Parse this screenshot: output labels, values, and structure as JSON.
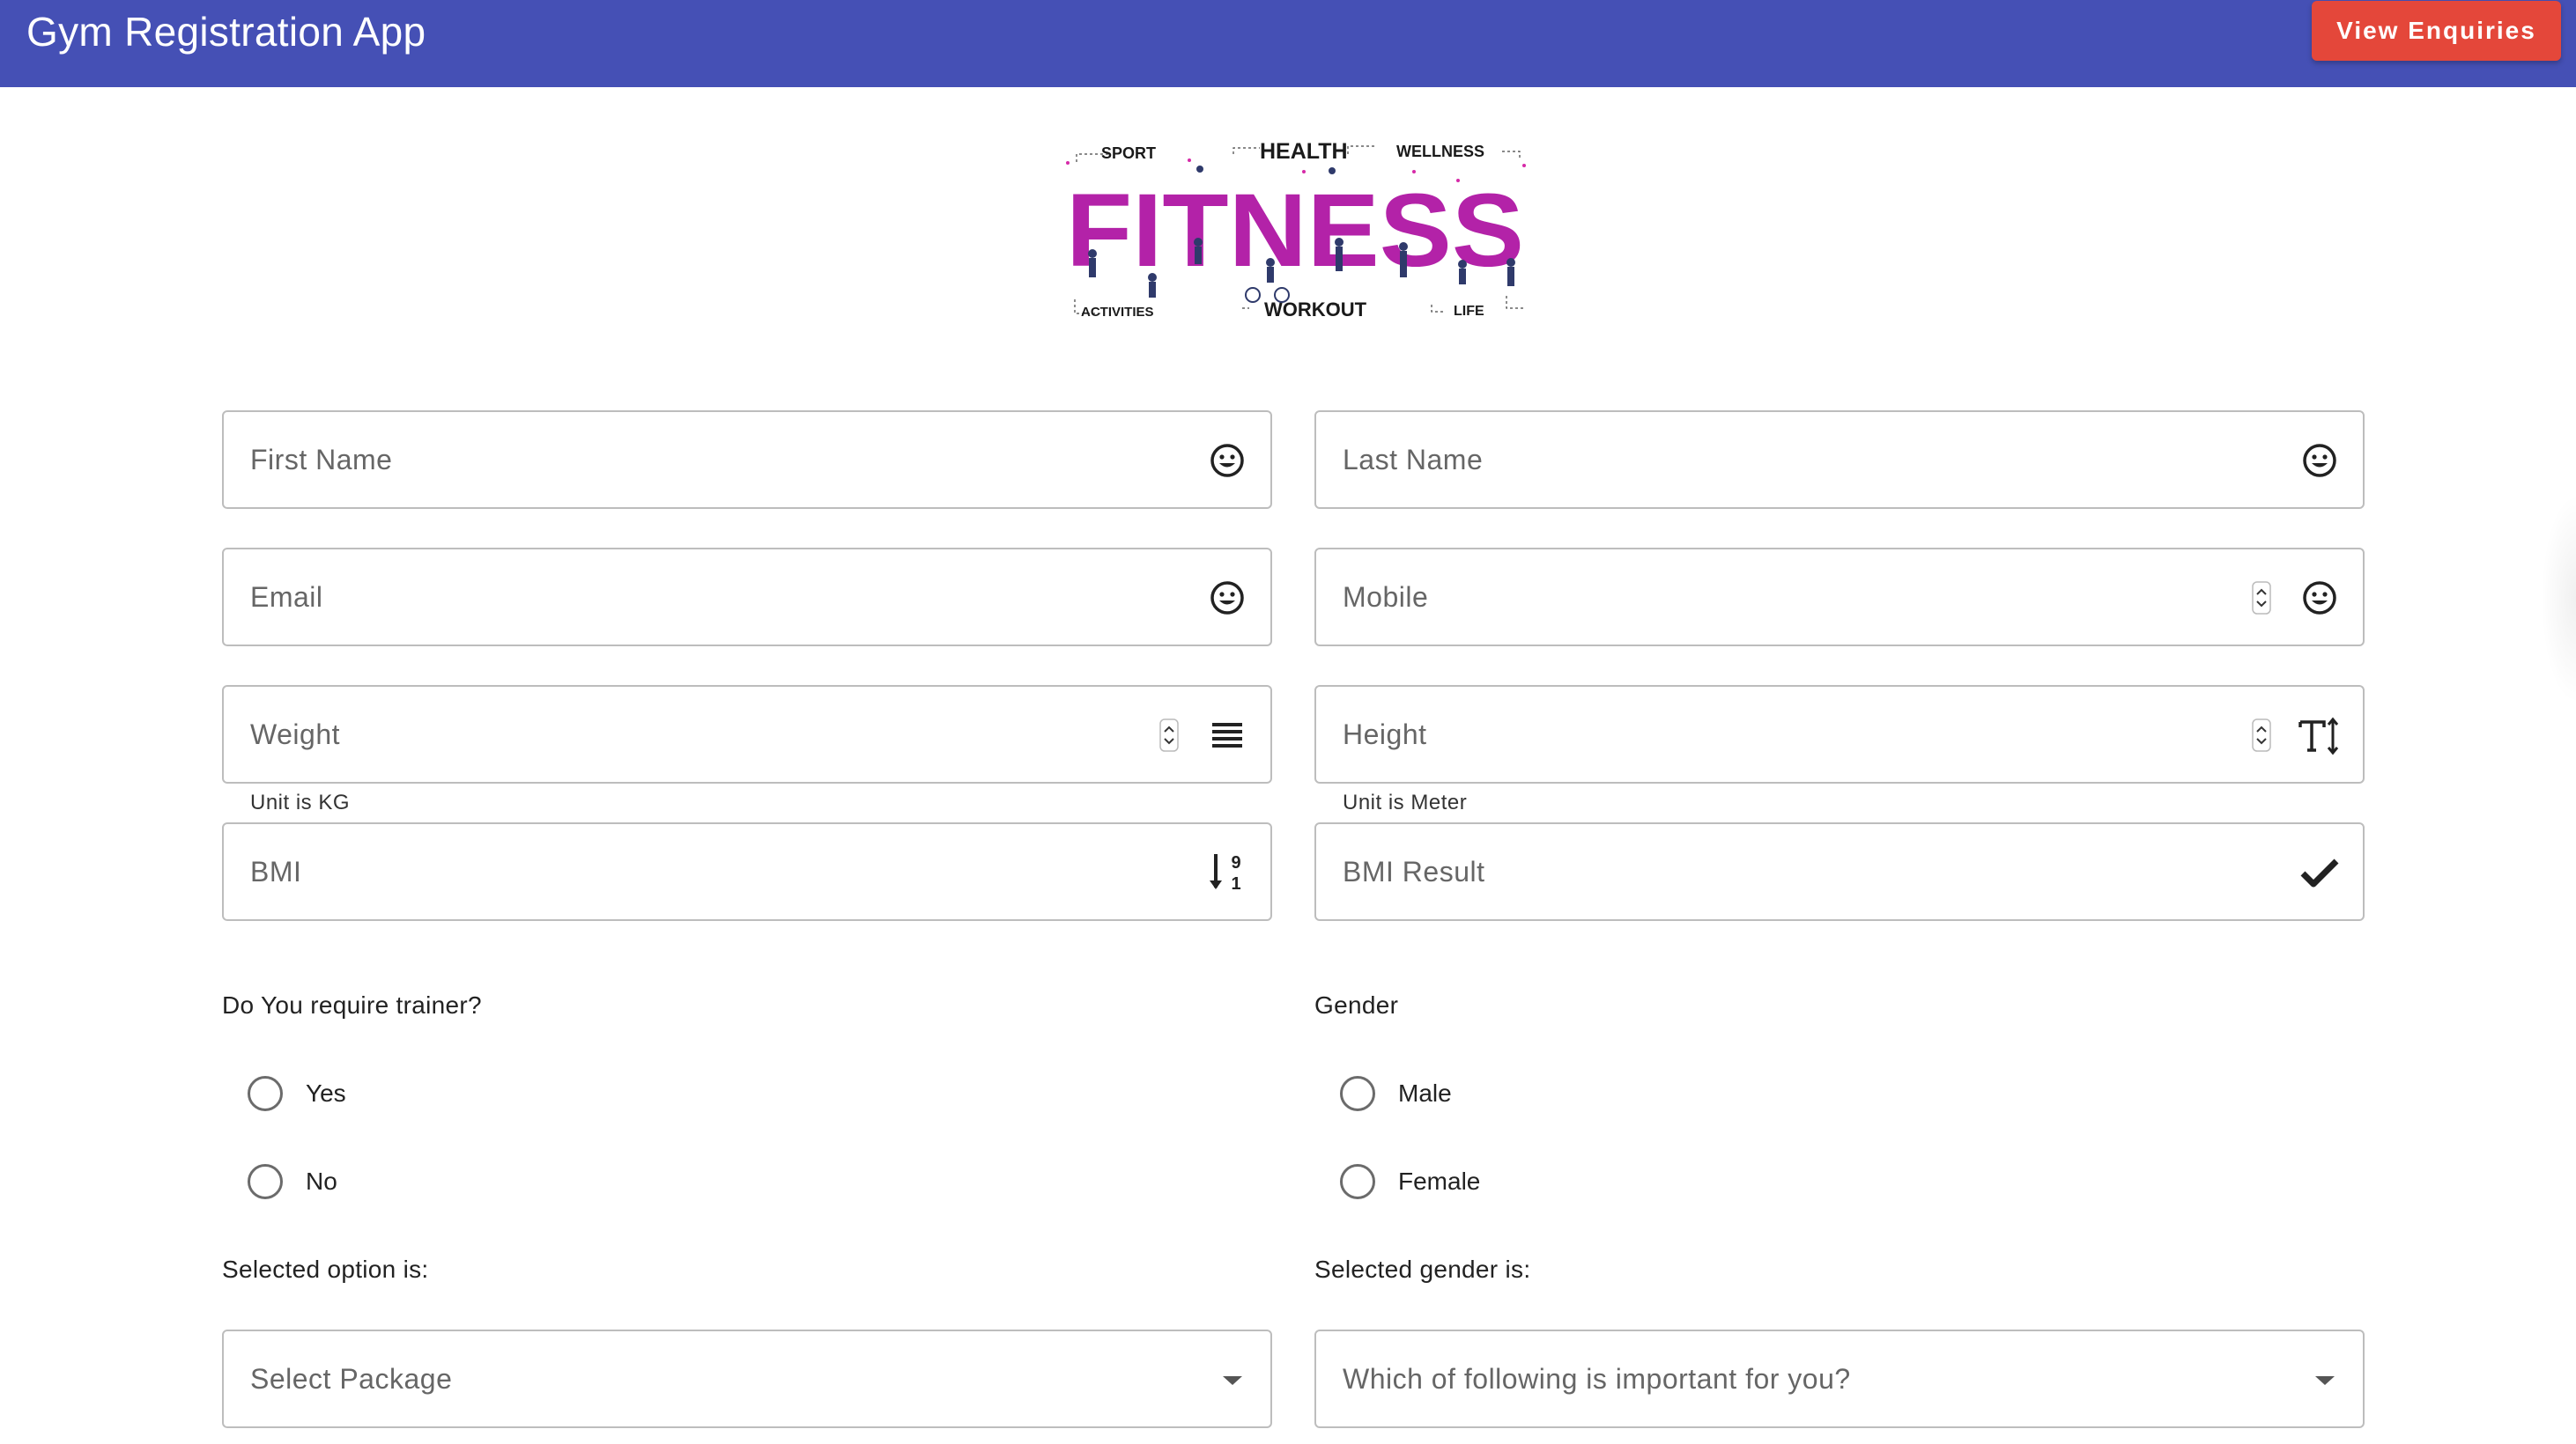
{
  "app": {
    "title": "Gym Registration App",
    "view_enquiries_label": "View Enquiries",
    "header_color": "#4550b5",
    "button_color": "#e4473a"
  },
  "logo": {
    "main_word": "FITNESS",
    "words": [
      "SPORT",
      "HEALTH",
      "WELLNESS",
      "ACTIVITIES",
      "WORKOUT",
      "LIFE"
    ],
    "color": "#b322a8"
  },
  "form": {
    "first_name": {
      "placeholder": "First Name",
      "icon": "smiley-icon"
    },
    "last_name": {
      "placeholder": "Last Name",
      "icon": "smiley-icon"
    },
    "email": {
      "placeholder": "Email",
      "icon": "smiley-icon"
    },
    "mobile": {
      "placeholder": "Mobile",
      "icon": "smiley-icon"
    },
    "weight": {
      "placeholder": "Weight",
      "hint": "Unit is KG",
      "icon": "lines-icon"
    },
    "height": {
      "placeholder": "Height",
      "hint": "Unit is Meter",
      "icon": "text-height-icon"
    },
    "bmi": {
      "placeholder": "BMI",
      "icon": "sort-numeric-icon"
    },
    "bmi_result": {
      "placeholder": "BMI Result",
      "icon": "check-icon"
    },
    "trainer": {
      "question": "Do You require trainer?",
      "options": [
        "Yes",
        "No"
      ],
      "selected_label": "Selected option is:"
    },
    "gender": {
      "question": "Gender",
      "options": [
        "Male",
        "Female"
      ],
      "selected_label": "Selected gender is:"
    },
    "package": {
      "placeholder": "Select Package"
    },
    "important": {
      "placeholder": "Which of following is important for you?"
    }
  }
}
